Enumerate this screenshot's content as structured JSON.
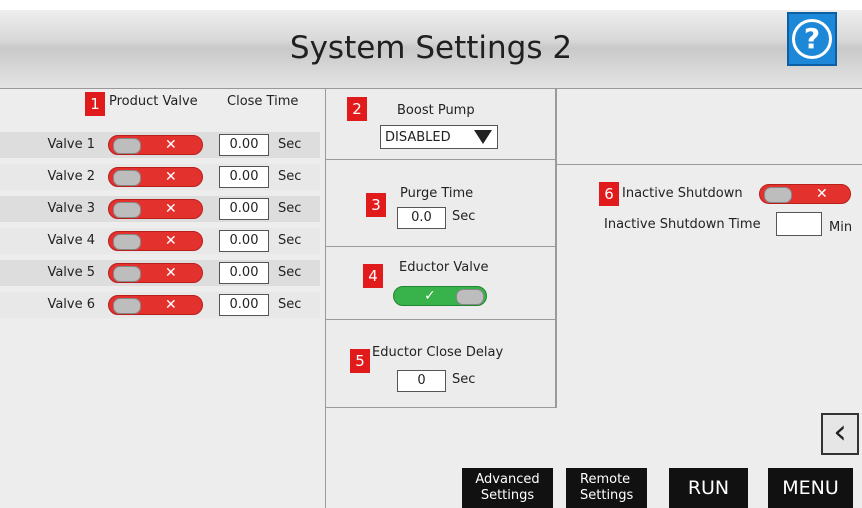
{
  "header": {
    "title": "System Settings 2",
    "help_icon": "?"
  },
  "section1": {
    "number": "1",
    "header_product_valve": "Product Valve",
    "header_close_time": "Close Time",
    "valves": [
      {
        "label": "Valve 1",
        "state": "off",
        "close_time": "0.00",
        "unit": "Sec"
      },
      {
        "label": "Valve 2",
        "state": "off",
        "close_time": "0.00",
        "unit": "Sec"
      },
      {
        "label": "Valve 3",
        "state": "off",
        "close_time": "0.00",
        "unit": "Sec"
      },
      {
        "label": "Valve 4",
        "state": "off",
        "close_time": "0.00",
        "unit": "Sec"
      },
      {
        "label": "Valve 5",
        "state": "off",
        "close_time": "0.00",
        "unit": "Sec"
      },
      {
        "label": "Valve 6",
        "state": "off",
        "close_time": "0.00",
        "unit": "Sec"
      }
    ]
  },
  "boost_pump": {
    "number": "2",
    "label": "Boost Pump",
    "selected": "DISABLED"
  },
  "purge_time": {
    "number": "3",
    "label": "Purge Time",
    "value": "0.0",
    "unit": "Sec"
  },
  "eductor_valve": {
    "number": "4",
    "label": "Eductor Valve",
    "state": "on"
  },
  "eductor_delay": {
    "number": "5",
    "label": "Eductor Close Delay",
    "value": "0",
    "unit": "Sec"
  },
  "inactive": {
    "number": "6",
    "label": "Inactive Shutdown",
    "state": "off",
    "time_label": "Inactive Shutdown Time",
    "time_value": "",
    "unit": "Min"
  },
  "buttons": {
    "advanced_line1": "Advanced",
    "advanced_line2": "Settings",
    "remote_line1": "Remote",
    "remote_line2": "Settings",
    "run": "RUN",
    "menu": "MENU",
    "back_icon": "‹"
  },
  "colors": {
    "toggle_off": "#e3322e",
    "toggle_on": "#38b24a",
    "badge": "#e11b1b",
    "help": "#1e88d8"
  }
}
